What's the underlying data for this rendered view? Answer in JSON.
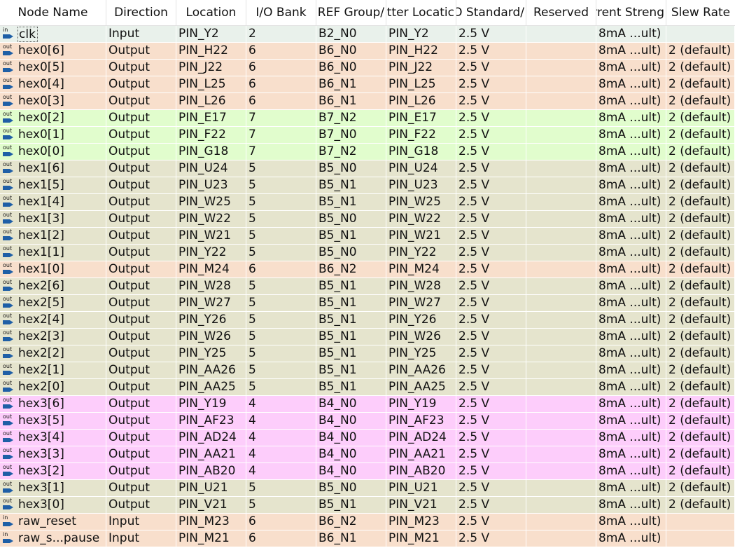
{
  "columns": [
    "Node Name",
    "Direction",
    "Location",
    "I/O Bank",
    "VREF Group",
    "Fitter Location",
    "I/O Standard",
    "Reserved",
    "Current Strength",
    "Slew Rate"
  ],
  "header_visible": [
    "Node Name",
    "Direction",
    "Location",
    "I/O Bank",
    "/REF Group",
    "tter Locatic",
    "/O Standard",
    "Reserved",
    "rrent Streng",
    "Slew Rate"
  ],
  "colors": {
    "clk_row": "#e9f1eb",
    "bank2": "#e9f1eb",
    "bank4": "#fdcdfb",
    "bank5": "#e5e4cd",
    "bank6": "#f8dfcc",
    "bank7": "#e1fdcd",
    "pin_icon": "#1f5fa6"
  },
  "rows": [
    {
      "direction_icon": "in",
      "name": "clk",
      "direction": "Input",
      "location": "PIN_Y2",
      "bank": "2",
      "vref": "B2_N0",
      "fitter": "PIN_Y2",
      "standard": "2.5 V",
      "reserved": "",
      "current": "8mA ...ult)",
      "slew": "",
      "color_key": "bank2",
      "focused": true
    },
    {
      "direction_icon": "out",
      "name": "hex0[6]",
      "direction": "Output",
      "location": "PIN_H22",
      "bank": "6",
      "vref": "B6_N0",
      "fitter": "PIN_H22",
      "standard": "2.5 V",
      "reserved": "",
      "current": "8mA ...ult)",
      "slew": "2 (default)",
      "color_key": "bank6"
    },
    {
      "direction_icon": "out",
      "name": "hex0[5]",
      "direction": "Output",
      "location": "PIN_J22",
      "bank": "6",
      "vref": "B6_N0",
      "fitter": "PIN_J22",
      "standard": "2.5 V",
      "reserved": "",
      "current": "8mA ...ult)",
      "slew": "2 (default)",
      "color_key": "bank6"
    },
    {
      "direction_icon": "out",
      "name": "hex0[4]",
      "direction": "Output",
      "location": "PIN_L25",
      "bank": "6",
      "vref": "B6_N1",
      "fitter": "PIN_L25",
      "standard": "2.5 V",
      "reserved": "",
      "current": "8mA ...ult)",
      "slew": "2 (default)",
      "color_key": "bank6"
    },
    {
      "direction_icon": "out",
      "name": "hex0[3]",
      "direction": "Output",
      "location": "PIN_L26",
      "bank": "6",
      "vref": "B6_N1",
      "fitter": "PIN_L26",
      "standard": "2.5 V",
      "reserved": "",
      "current": "8mA ...ult)",
      "slew": "2 (default)",
      "color_key": "bank6"
    },
    {
      "direction_icon": "out",
      "name": "hex0[2]",
      "direction": "Output",
      "location": "PIN_E17",
      "bank": "7",
      "vref": "B7_N2",
      "fitter": "PIN_E17",
      "standard": "2.5 V",
      "reserved": "",
      "current": "8mA ...ult)",
      "slew": "2 (default)",
      "color_key": "bank7"
    },
    {
      "direction_icon": "out",
      "name": "hex0[1]",
      "direction": "Output",
      "location": "PIN_F22",
      "bank": "7",
      "vref": "B7_N0",
      "fitter": "PIN_F22",
      "standard": "2.5 V",
      "reserved": "",
      "current": "8mA ...ult)",
      "slew": "2 (default)",
      "color_key": "bank7"
    },
    {
      "direction_icon": "out",
      "name": "hex0[0]",
      "direction": "Output",
      "location": "PIN_G18",
      "bank": "7",
      "vref": "B7_N2",
      "fitter": "PIN_G18",
      "standard": "2.5 V",
      "reserved": "",
      "current": "8mA ...ult)",
      "slew": "2 (default)",
      "color_key": "bank7"
    },
    {
      "direction_icon": "out",
      "name": "hex1[6]",
      "direction": "Output",
      "location": "PIN_U24",
      "bank": "5",
      "vref": "B5_N0",
      "fitter": "PIN_U24",
      "standard": "2.5 V",
      "reserved": "",
      "current": "8mA ...ult)",
      "slew": "2 (default)",
      "color_key": "bank5"
    },
    {
      "direction_icon": "out",
      "name": "hex1[5]",
      "direction": "Output",
      "location": "PIN_U23",
      "bank": "5",
      "vref": "B5_N1",
      "fitter": "PIN_U23",
      "standard": "2.5 V",
      "reserved": "",
      "current": "8mA ...ult)",
      "slew": "2 (default)",
      "color_key": "bank5"
    },
    {
      "direction_icon": "out",
      "name": "hex1[4]",
      "direction": "Output",
      "location": "PIN_W25",
      "bank": "5",
      "vref": "B5_N1",
      "fitter": "PIN_W25",
      "standard": "2.5 V",
      "reserved": "",
      "current": "8mA ...ult)",
      "slew": "2 (default)",
      "color_key": "bank5"
    },
    {
      "direction_icon": "out",
      "name": "hex1[3]",
      "direction": "Output",
      "location": "PIN_W22",
      "bank": "5",
      "vref": "B5_N0",
      "fitter": "PIN_W22",
      "standard": "2.5 V",
      "reserved": "",
      "current": "8mA ...ult)",
      "slew": "2 (default)",
      "color_key": "bank5"
    },
    {
      "direction_icon": "out",
      "name": "hex1[2]",
      "direction": "Output",
      "location": "PIN_W21",
      "bank": "5",
      "vref": "B5_N1",
      "fitter": "PIN_W21",
      "standard": "2.5 V",
      "reserved": "",
      "current": "8mA ...ult)",
      "slew": "2 (default)",
      "color_key": "bank5"
    },
    {
      "direction_icon": "out",
      "name": "hex1[1]",
      "direction": "Output",
      "location": "PIN_Y22",
      "bank": "5",
      "vref": "B5_N0",
      "fitter": "PIN_Y22",
      "standard": "2.5 V",
      "reserved": "",
      "current": "8mA ...ult)",
      "slew": "2 (default)",
      "color_key": "bank5"
    },
    {
      "direction_icon": "out",
      "name": "hex1[0]",
      "direction": "Output",
      "location": "PIN_M24",
      "bank": "6",
      "vref": "B6_N2",
      "fitter": "PIN_M24",
      "standard": "2.5 V",
      "reserved": "",
      "current": "8mA ...ult)",
      "slew": "2 (default)",
      "color_key": "bank6"
    },
    {
      "direction_icon": "out",
      "name": "hex2[6]",
      "direction": "Output",
      "location": "PIN_W28",
      "bank": "5",
      "vref": "B5_N1",
      "fitter": "PIN_W28",
      "standard": "2.5 V",
      "reserved": "",
      "current": "8mA ...ult)",
      "slew": "2 (default)",
      "color_key": "bank5"
    },
    {
      "direction_icon": "out",
      "name": "hex2[5]",
      "direction": "Output",
      "location": "PIN_W27",
      "bank": "5",
      "vref": "B5_N1",
      "fitter": "PIN_W27",
      "standard": "2.5 V",
      "reserved": "",
      "current": "8mA ...ult)",
      "slew": "2 (default)",
      "color_key": "bank5"
    },
    {
      "direction_icon": "out",
      "name": "hex2[4]",
      "direction": "Output",
      "location": "PIN_Y26",
      "bank": "5",
      "vref": "B5_N1",
      "fitter": "PIN_Y26",
      "standard": "2.5 V",
      "reserved": "",
      "current": "8mA ...ult)",
      "slew": "2 (default)",
      "color_key": "bank5"
    },
    {
      "direction_icon": "out",
      "name": "hex2[3]",
      "direction": "Output",
      "location": "PIN_W26",
      "bank": "5",
      "vref": "B5_N1",
      "fitter": "PIN_W26",
      "standard": "2.5 V",
      "reserved": "",
      "current": "8mA ...ult)",
      "slew": "2 (default)",
      "color_key": "bank5"
    },
    {
      "direction_icon": "out",
      "name": "hex2[2]",
      "direction": "Output",
      "location": "PIN_Y25",
      "bank": "5",
      "vref": "B5_N1",
      "fitter": "PIN_Y25",
      "standard": "2.5 V",
      "reserved": "",
      "current": "8mA ...ult)",
      "slew": "2 (default)",
      "color_key": "bank5"
    },
    {
      "direction_icon": "out",
      "name": "hex2[1]",
      "direction": "Output",
      "location": "PIN_AA26",
      "bank": "5",
      "vref": "B5_N1",
      "fitter": "PIN_AA26",
      "standard": "2.5 V",
      "reserved": "",
      "current": "8mA ...ult)",
      "slew": "2 (default)",
      "color_key": "bank5"
    },
    {
      "direction_icon": "out",
      "name": "hex2[0]",
      "direction": "Output",
      "location": "PIN_AA25",
      "bank": "5",
      "vref": "B5_N1",
      "fitter": "PIN_AA25",
      "standard": "2.5 V",
      "reserved": "",
      "current": "8mA ...ult)",
      "slew": "2 (default)",
      "color_key": "bank5"
    },
    {
      "direction_icon": "out",
      "name": "hex3[6]",
      "direction": "Output",
      "location": "PIN_Y19",
      "bank": "4",
      "vref": "B4_N0",
      "fitter": "PIN_Y19",
      "standard": "2.5 V",
      "reserved": "",
      "current": "8mA ...ult)",
      "slew": "2 (default)",
      "color_key": "bank4"
    },
    {
      "direction_icon": "out",
      "name": "hex3[5]",
      "direction": "Output",
      "location": "PIN_AF23",
      "bank": "4",
      "vref": "B4_N0",
      "fitter": "PIN_AF23",
      "standard": "2.5 V",
      "reserved": "",
      "current": "8mA ...ult)",
      "slew": "2 (default)",
      "color_key": "bank4"
    },
    {
      "direction_icon": "out",
      "name": "hex3[4]",
      "direction": "Output",
      "location": "PIN_AD24",
      "bank": "4",
      "vref": "B4_N0",
      "fitter": "PIN_AD24",
      "standard": "2.5 V",
      "reserved": "",
      "current": "8mA ...ult)",
      "slew": "2 (default)",
      "color_key": "bank4"
    },
    {
      "direction_icon": "out",
      "name": "hex3[3]",
      "direction": "Output",
      "location": "PIN_AA21",
      "bank": "4",
      "vref": "B4_N0",
      "fitter": "PIN_AA21",
      "standard": "2.5 V",
      "reserved": "",
      "current": "8mA ...ult)",
      "slew": "2 (default)",
      "color_key": "bank4"
    },
    {
      "direction_icon": "out",
      "name": "hex3[2]",
      "direction": "Output",
      "location": "PIN_AB20",
      "bank": "4",
      "vref": "B4_N0",
      "fitter": "PIN_AB20",
      "standard": "2.5 V",
      "reserved": "",
      "current": "8mA ...ult)",
      "slew": "2 (default)",
      "color_key": "bank4"
    },
    {
      "direction_icon": "out",
      "name": "hex3[1]",
      "direction": "Output",
      "location": "PIN_U21",
      "bank": "5",
      "vref": "B5_N0",
      "fitter": "PIN_U21",
      "standard": "2.5 V",
      "reserved": "",
      "current": "8mA ...ult)",
      "slew": "2 (default)",
      "color_key": "bank5"
    },
    {
      "direction_icon": "out",
      "name": "hex3[0]",
      "direction": "Output",
      "location": "PIN_V21",
      "bank": "5",
      "vref": "B5_N1",
      "fitter": "PIN_V21",
      "standard": "2.5 V",
      "reserved": "",
      "current": "8mA ...ult)",
      "slew": "2 (default)",
      "color_key": "bank5"
    },
    {
      "direction_icon": "in",
      "name": "raw_reset",
      "direction": "Input",
      "location": "PIN_M23",
      "bank": "6",
      "vref": "B6_N2",
      "fitter": "PIN_M23",
      "standard": "2.5 V",
      "reserved": "",
      "current": "8mA ...ult)",
      "slew": "",
      "color_key": "bank6"
    },
    {
      "direction_icon": "in",
      "name": "raw_s...pause",
      "direction": "Input",
      "location": "PIN_M21",
      "bank": "6",
      "vref": "B6_N1",
      "fitter": "PIN_M21",
      "standard": "2.5 V",
      "reserved": "",
      "current": "8mA ...ult)",
      "slew": "",
      "color_key": "bank6"
    }
  ]
}
